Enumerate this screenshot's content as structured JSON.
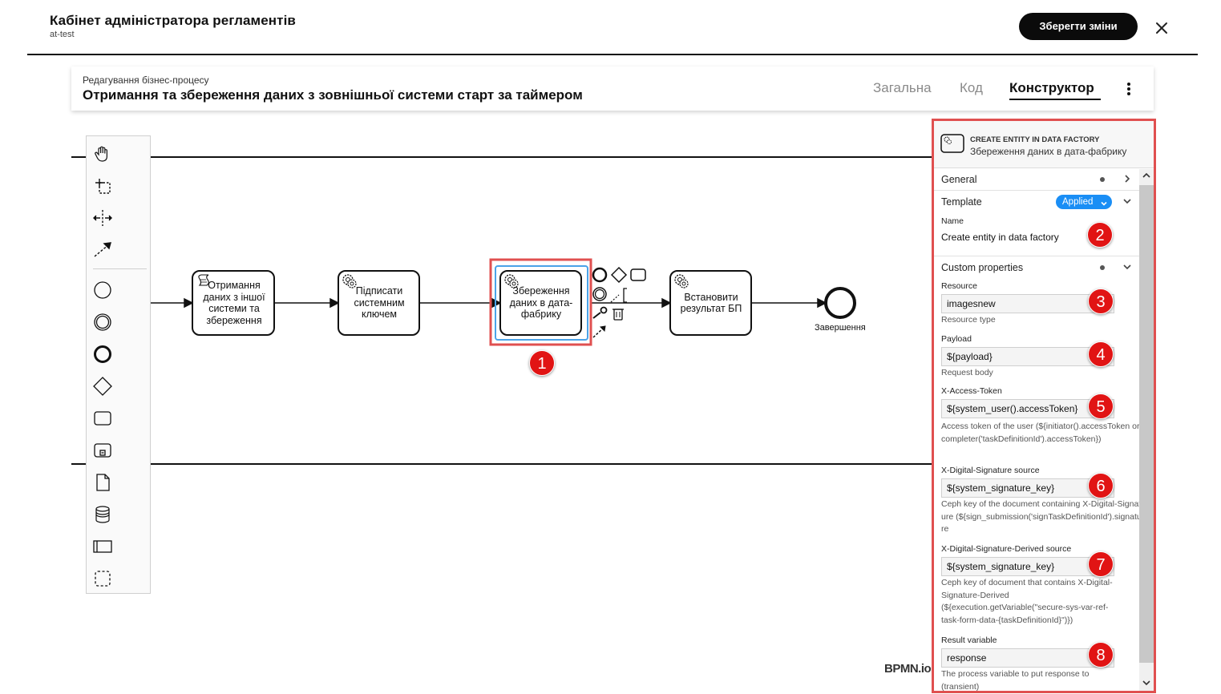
{
  "header": {
    "title": "Кабінет адміністратора регламентів",
    "subtitle": "at-test",
    "save_label": "Зберегти зміни"
  },
  "process": {
    "label": "Редагування бізнес-процесу",
    "name": "Отримання та збереження даних з зовнішньої системи старт за таймером",
    "tabs": [
      "Загальна",
      "Код",
      "Конструктор"
    ],
    "active_tab": "Конструктор"
  },
  "diagram": {
    "nodes": [
      {
        "label": "Отримання даних з іншої системи та збереження",
        "type": "script-task"
      },
      {
        "label": "Підписати системним ключем",
        "type": "service-task"
      },
      {
        "label": "Збереження даних в дата-фабрику",
        "type": "service-task",
        "selected": true
      },
      {
        "label": "Встановити результат БП",
        "type": "service-task"
      }
    ],
    "end_event": "Завершення",
    "watermark": "BPMN.io"
  },
  "palette": {
    "tools": [
      "hand-tool-icon",
      "lasso-tool-icon",
      "space-tool-icon",
      "connect-tool-icon"
    ],
    "shapes": [
      "start-event-icon",
      "intermediate-event-icon",
      "end-event-icon",
      "gateway-icon",
      "task-icon",
      "subprocess-icon",
      "data-object-icon",
      "data-store-icon",
      "participant-icon",
      "group-icon"
    ]
  },
  "properties": {
    "element_type": "CREATE ENTITY IN DATA FACTORY",
    "element_name": "Збереження даних в дата-фабрику",
    "sections": {
      "general": "General",
      "template": "Template",
      "template_status": "Applied",
      "custom": "Custom properties"
    },
    "name_label": "Name",
    "name_value": "Create entity in data factory",
    "fields": [
      {
        "label": "Resource",
        "value": "imagesnew",
        "hint": "Resource type"
      },
      {
        "label": "Payload",
        "value": "${payload}",
        "hint": "Request body"
      },
      {
        "label": "X-Access-Token",
        "value": "${system_user().accessToken}",
        "hint": "Access token of the user (${initiator().accessToken or completer('taskDefinitionId').accessToken})"
      },
      {
        "label": "X-Digital-Signature source",
        "value": "${system_signature_key}",
        "hint": "Ceph key of the document containing X-Digital-Signature (${sign_submission('signTaskDefinitionId').signature"
      },
      {
        "label": "X-Digital-Signature-Derived source",
        "value": "${system_signature_key}",
        "hint": "Ceph key of document that contains X-Digital-Signature-Derived (${execution.getVariable(\"secure-sys-var-ref-task-form-data-{taskDefinitionId}\")})"
      },
      {
        "label": "Result variable",
        "value": "response",
        "hint": "The process variable to put response to (transient)"
      }
    ]
  },
  "annotations": [
    "1",
    "2",
    "3",
    "4",
    "5",
    "6",
    "7",
    "8"
  ],
  "colors": {
    "accent": "#1a8ef5",
    "highlight": "#e05050",
    "badge": "#e11414",
    "selection": "#4ba3e8"
  }
}
